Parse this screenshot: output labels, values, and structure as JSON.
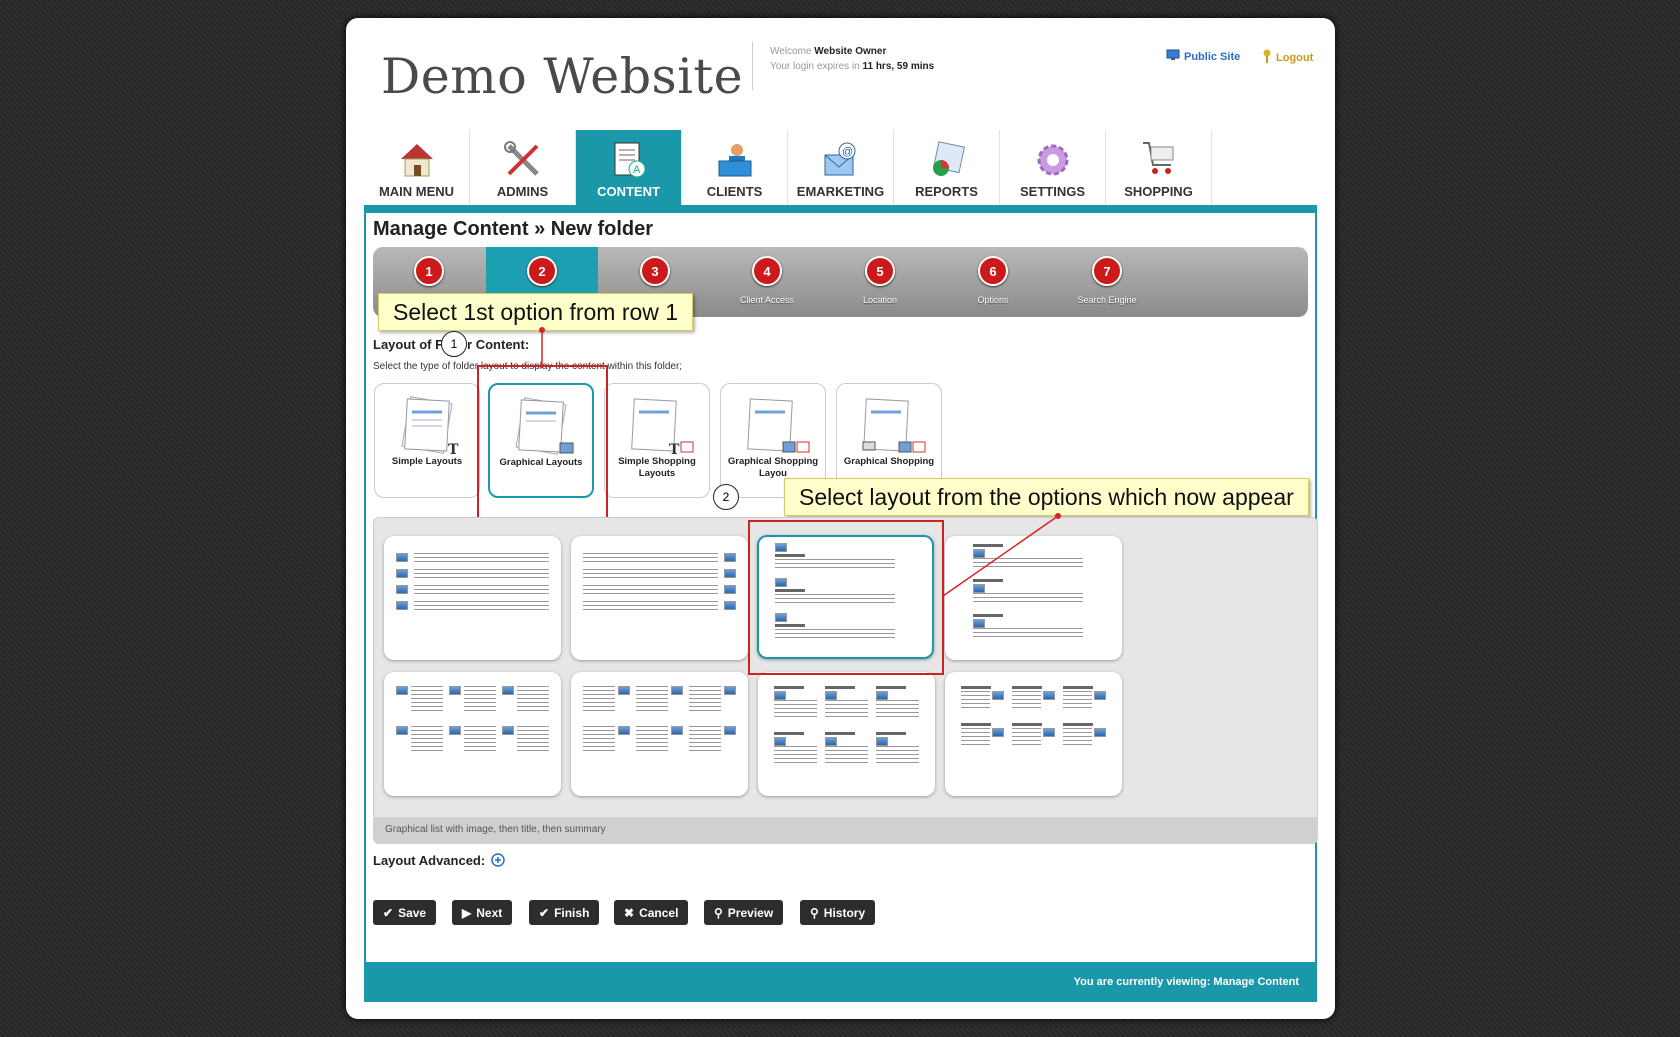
{
  "header": {
    "logo": "Demo Website",
    "welcome_prefix": "Welcome",
    "user": "Website Owner",
    "expires_prefix": "Your login expires in",
    "expires": "11 hrs, 59 mins",
    "public_site": "Public Site",
    "logout": "Logout"
  },
  "nav": [
    {
      "label": "MAIN MENU",
      "icon": "house-icon"
    },
    {
      "label": "ADMINS",
      "icon": "tools-icon"
    },
    {
      "label": "CONTENT",
      "icon": "document-icon"
    },
    {
      "label": "CLIENTS",
      "icon": "clients-icon"
    },
    {
      "label": "EMARKETING",
      "icon": "email-icon"
    },
    {
      "label": "REPORTS",
      "icon": "reports-icon"
    },
    {
      "label": "SETTINGS",
      "icon": "gear-icon"
    },
    {
      "label": "SHOPPING",
      "icon": "cart-icon"
    }
  ],
  "page_title": "Manage Content » New folder",
  "steps": [
    {
      "num": "1",
      "label": ""
    },
    {
      "num": "2",
      "label": ""
    },
    {
      "num": "3",
      "label": ""
    },
    {
      "num": "4",
      "label": "Client Access"
    },
    {
      "num": "5",
      "label": "Location"
    },
    {
      "num": "6",
      "label": "Options"
    },
    {
      "num": "7",
      "label": "Search Engine"
    }
  ],
  "callouts": {
    "c1": "Select 1st option from row 1",
    "c2": "Select layout from the options which now appear",
    "n1": "1",
    "n2": "2"
  },
  "layout_section": {
    "title_a": "Layout of F",
    "title_b": "r Content:",
    "desc": "Select the type of folder layout to display the content within this folder;"
  },
  "layout_types": [
    "Simple Layouts",
    "Graphical Layouts",
    "Simple Shopping Layouts",
    "Graphical Shopping Layou",
    "Graphical Shopping"
  ],
  "gallery_status": "Graphical list with image, then title, then summary",
  "layout_advanced": "Layout Advanced:",
  "buttons": {
    "save": "Save",
    "next": "Next",
    "finish": "Finish",
    "cancel": "Cancel",
    "preview": "Preview",
    "history": "History"
  },
  "footer": "You are currently viewing: Manage Content",
  "colors": {
    "teal": "#1a98a9",
    "step_red": "#cc1a1a",
    "callout": "#ffffcc"
  }
}
